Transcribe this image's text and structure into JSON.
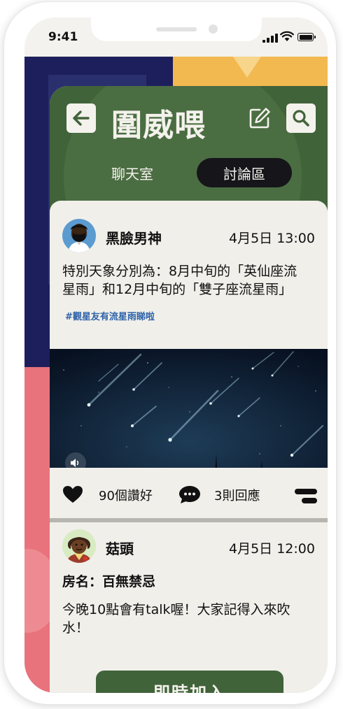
{
  "status_bar": {
    "time": "9:41"
  },
  "app": {
    "title": "圍威喂"
  },
  "tabs": [
    {
      "label": "聊天室",
      "active": false
    },
    {
      "label": "討論區",
      "active": true
    }
  ],
  "posts": [
    {
      "username": "黑臉男神",
      "datetime": "4月5日 13:00",
      "text_line1": "特別天象分別為：8月中旬的「英仙座流",
      "text_line2": "星雨」和12月中旬的「雙子座流星雨」",
      "hashtag": "#觀星友有流星雨睇啦",
      "likes_label": "90個讚好",
      "replies_label": "3則回應"
    },
    {
      "username": "菇頭",
      "datetime": "4月5日 12:00",
      "room_label": "房名：百無禁忌",
      "text_line1": "今晚10點會有talk喔！大家記得入來吹",
      "text_line2": "水！",
      "join_label": "即時加入"
    }
  ],
  "icons": {
    "back": "arrow-left-icon",
    "edit": "edit-icon",
    "search": "search-icon",
    "like": "heart-icon",
    "reply": "chat-bubble-icon",
    "more": "more-icon",
    "sound": "speaker-icon"
  },
  "colors": {
    "header_green": "#41633a",
    "active_tab": "#15151a",
    "navy": "#1d1f5c",
    "yellow": "#f2b950",
    "pink": "#e8737c",
    "hashtag_blue": "#2e63a8"
  }
}
